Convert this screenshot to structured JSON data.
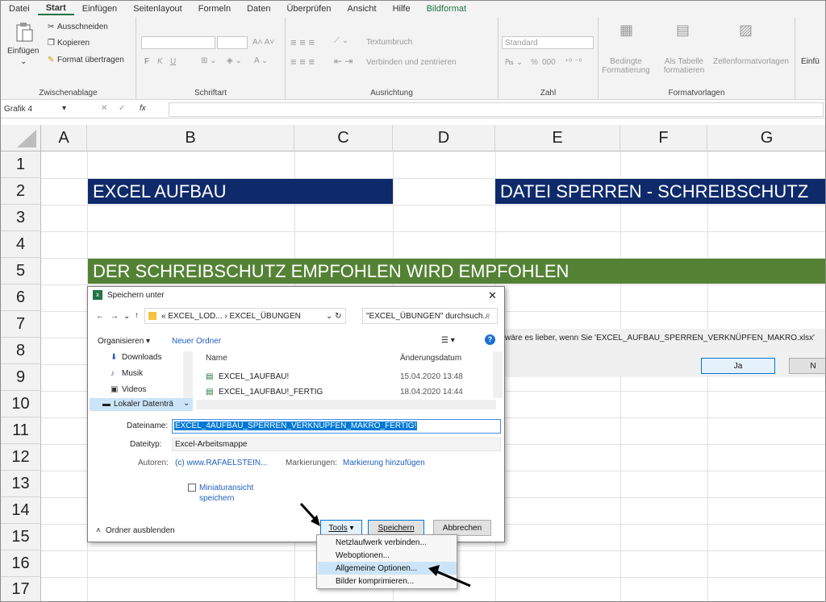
{
  "menu_tabs": [
    "Datei",
    "Start",
    "Einfügen",
    "Seitenlayout",
    "Formeln",
    "Daten",
    "Überprüfen",
    "Ansicht",
    "Hilfe",
    "Bildformat"
  ],
  "ribbon": {
    "paste_label": "Einfügen",
    "cut": "Ausschneiden",
    "copy": "Kopieren",
    "format_painter": "Format übertragen",
    "clipboard_group": "Zwischenablage",
    "font_group": "Schriftart",
    "bold": "F",
    "italic": "K",
    "underline": "U",
    "wrap_text": "Textumbruch",
    "merge_center": "Verbinden und zentrieren",
    "alignment_group": "Ausrichtung",
    "number_format": "Standard",
    "percent": "%",
    "thousands": "000",
    "number_group": "Zahl",
    "conditional": "Bedingte Formatierung",
    "as_table": "Als Tabelle formatieren",
    "cell_styles": "Zellenformatvorlagen",
    "styles_group": "Formatvorlagen",
    "insert_cut": "Einfü"
  },
  "formula_bar": {
    "name_box": "Grafik 4",
    "fx": "fx"
  },
  "columns": [
    "A",
    "B",
    "C",
    "D",
    "E",
    "F",
    "G"
  ],
  "rows": [
    "1",
    "2",
    "3",
    "4",
    "5",
    "6",
    "7",
    "8",
    "9",
    "10",
    "11",
    "12",
    "13",
    "14",
    "15",
    "16",
    "17"
  ],
  "banners": {
    "excel_aufbau": "EXCEL AUFBAU",
    "datei_sperren": "DATEI SPERREN - SCHREIBSCHUTZ",
    "schreibschutz": "DER SCHREIBSCHUTZ EMPFOHLEN WIRD EMPFOHLEN"
  },
  "colors": {
    "navy": "#0f2a6b",
    "green": "#548235",
    "excel_green": "#217346",
    "highlight": "#cce4f7",
    "link": "#1f5fbf"
  },
  "message": {
    "text": "wäre es lieber, wenn Sie 'EXCEL_AUFBAU_SPERREN_VERKNÜPFEN_MAKRO.xlsx'",
    "yes": "Ja",
    "no": "N"
  },
  "dialog": {
    "title": "Speichern unter",
    "close": "✕",
    "path": "« EXCEL_LOD... › EXCEL_ÜBUNGEN",
    "search_placeholder": "\"EXCEL_ÜBUNGEN\" durchsuch...",
    "organize": "Organisieren ▾",
    "new_folder": "Neuer Ordner",
    "nav_items": [
      "Downloads",
      "Musik",
      "Videos",
      "Lokaler Datenträ"
    ],
    "col_name": "Name",
    "col_date": "Änderungsdatum",
    "files": [
      {
        "name": "EXCEL_1AUFBAU!",
        "date": "15.04.2020 13:48"
      },
      {
        "name": "EXCEL_1AUFBAU!_FERTIG",
        "date": "18.04.2020 14:44"
      }
    ],
    "filename_label": "Dateiname:",
    "filename_value": "EXCEL_4AUFBAU_SPERREN_VERKNÜPFEN_MAKRO_FERTIG!",
    "filetype_label": "Dateityp:",
    "filetype_value": "Excel-Arbeitsmappe",
    "authors_label": "Autoren:",
    "authors_value": "(c) www.RAFAELSTEIN...",
    "tags_label": "Markierungen:",
    "tags_value": "Markierung hinzufügen",
    "thumbnail_label": "Miniaturansicht speichern",
    "hide_folders": "Ordner ausblenden",
    "tools": "Tools",
    "save": "Speichern",
    "cancel": "Abbrechen"
  },
  "tools_menu": [
    "Netzlaufwerk verbinden...",
    "Weboptionen...",
    "Allgemeine Optionen...",
    "Bilder komprimieren..."
  ]
}
